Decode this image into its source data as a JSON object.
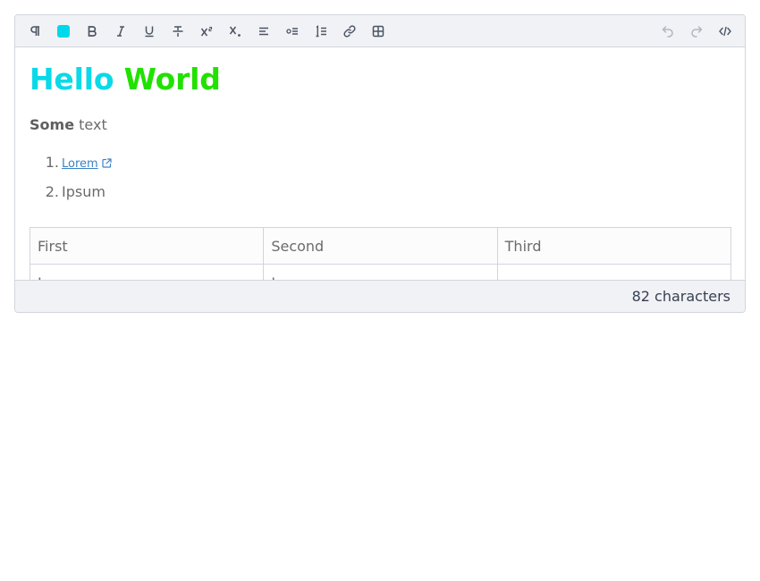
{
  "toolbar": {
    "buttons": [
      {
        "name": "paragraph",
        "icon": "pilcrow-icon"
      },
      {
        "name": "text-color",
        "icon": "color-swatch-icon",
        "color": "#00d9e9"
      },
      {
        "name": "bold",
        "icon": "bold-icon"
      },
      {
        "name": "italic",
        "icon": "italic-icon"
      },
      {
        "name": "underline",
        "icon": "underline-icon"
      },
      {
        "name": "strikethrough",
        "icon": "strikethrough-icon"
      },
      {
        "name": "superscript",
        "icon": "superscript-icon"
      },
      {
        "name": "subscript",
        "icon": "subscript-icon"
      },
      {
        "name": "align-left",
        "icon": "align-left-icon"
      },
      {
        "name": "bullet-list",
        "icon": "bullet-list-icon"
      },
      {
        "name": "ordered-list",
        "icon": "ordered-list-icon"
      },
      {
        "name": "link",
        "icon": "link-icon"
      },
      {
        "name": "table",
        "icon": "table-icon"
      }
    ],
    "right_buttons": [
      {
        "name": "undo",
        "icon": "undo-icon",
        "disabled": true
      },
      {
        "name": "redo",
        "icon": "redo-icon",
        "disabled": true
      },
      {
        "name": "source-code",
        "icon": "code-icon"
      }
    ]
  },
  "content": {
    "heading": {
      "word1": "Hello",
      "word1_color": "#0ad9e8",
      "space": " ",
      "word2": "World",
      "word2_color": "#22e100"
    },
    "paragraph": {
      "bold": "Some",
      "rest": " text"
    },
    "list": [
      {
        "number": "1.",
        "text": "Lorem",
        "is_link": true
      },
      {
        "number": "2.",
        "text": "Ipsum",
        "is_link": false
      }
    ],
    "table": {
      "headers": [
        "First",
        "Second",
        "Third"
      ],
      "rows": [
        [
          "I",
          "I",
          ""
        ]
      ]
    }
  },
  "footer": {
    "char_count": "82 characters"
  },
  "colors": {
    "link": "#3b82c4",
    "toolbar_bg": "#f1f2f6",
    "border": "#d1d5db",
    "icon": "#4b5563",
    "icon_disabled": "#b3b6bd"
  }
}
